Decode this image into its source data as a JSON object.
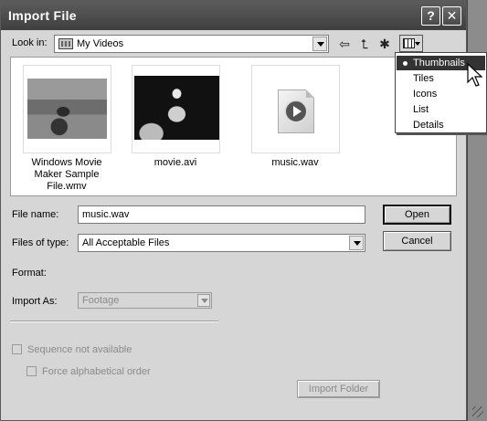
{
  "window": {
    "title": "Import File"
  },
  "titlebar": {
    "help_glyph": "?",
    "close_glyph": "✕"
  },
  "lookin": {
    "label": "Look in:",
    "value": "My Videos",
    "back_glyph": "⇦",
    "up_glyph": "⮤",
    "newfolder_glyph": "✱"
  },
  "files": [
    {
      "name": "Windows Movie Maker Sample File.wmv",
      "icon": "video-thumbnail"
    },
    {
      "name": "movie.avi",
      "icon": "video-thumbnail"
    },
    {
      "name": "music.wav",
      "icon": "audio-file-icon"
    }
  ],
  "filename": {
    "label": "File name:",
    "value": "music.wav"
  },
  "filetype": {
    "label": "Files of type:",
    "value": "All Acceptable Files"
  },
  "buttons": {
    "open": "Open",
    "cancel": "Cancel",
    "import_folder": "Import Folder"
  },
  "format": {
    "label": "Format:"
  },
  "import_as": {
    "label": "Import As:",
    "value": "Footage"
  },
  "sequence": {
    "label": "Sequence not available",
    "checked": false
  },
  "force_alpha": {
    "label": "Force alphabetical order",
    "checked": false
  },
  "view_menu": {
    "selected": "Thumbnails",
    "items": [
      "Thumbnails",
      "Tiles",
      "Icons",
      "List",
      "Details"
    ]
  }
}
